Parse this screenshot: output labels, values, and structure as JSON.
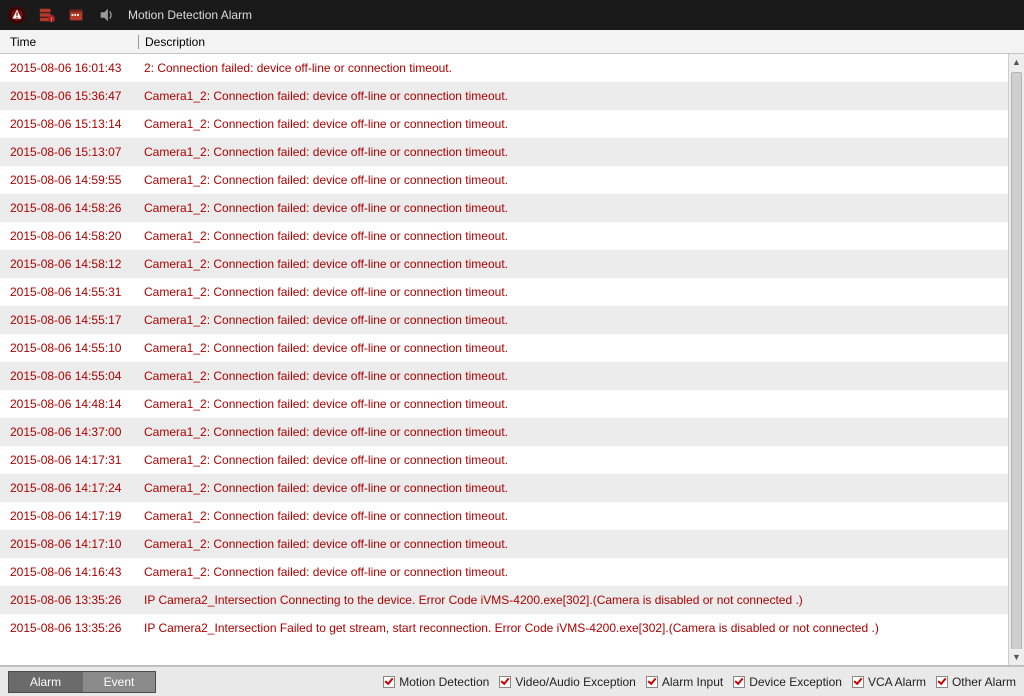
{
  "topbar": {
    "title": "Motion Detection Alarm",
    "icons": [
      "alert-icon",
      "server-alert-icon",
      "calendar-icon",
      "sound-icon"
    ]
  },
  "columns": {
    "time": "Time",
    "description": "Description"
  },
  "rows": [
    {
      "time": "2015-08-06 16:01:43",
      "desc": "2: Connection failed: device off-line or connection timeout."
    },
    {
      "time": "2015-08-06 15:36:47",
      "desc": "Camera1_2: Connection failed: device off-line or connection timeout."
    },
    {
      "time": "2015-08-06 15:13:14",
      "desc": "Camera1_2: Connection failed: device off-line or connection timeout."
    },
    {
      "time": "2015-08-06 15:13:07",
      "desc": "Camera1_2: Connection failed: device off-line or connection timeout."
    },
    {
      "time": "2015-08-06 14:59:55",
      "desc": "Camera1_2: Connection failed: device off-line or connection timeout."
    },
    {
      "time": "2015-08-06 14:58:26",
      "desc": "Camera1_2: Connection failed: device off-line or connection timeout."
    },
    {
      "time": "2015-08-06 14:58:20",
      "desc": "Camera1_2: Connection failed: device off-line or connection timeout."
    },
    {
      "time": "2015-08-06 14:58:12",
      "desc": "Camera1_2: Connection failed: device off-line or connection timeout."
    },
    {
      "time": "2015-08-06 14:55:31",
      "desc": "Camera1_2: Connection failed: device off-line or connection timeout."
    },
    {
      "time": "2015-08-06 14:55:17",
      "desc": "Camera1_2: Connection failed: device off-line or connection timeout."
    },
    {
      "time": "2015-08-06 14:55:10",
      "desc": "Camera1_2: Connection failed: device off-line or connection timeout."
    },
    {
      "time": "2015-08-06 14:55:04",
      "desc": "Camera1_2: Connection failed: device off-line or connection timeout."
    },
    {
      "time": "2015-08-06 14:48:14",
      "desc": "Camera1_2: Connection failed: device off-line or connection timeout."
    },
    {
      "time": "2015-08-06 14:37:00",
      "desc": "Camera1_2: Connection failed: device off-line or connection timeout."
    },
    {
      "time": "2015-08-06 14:17:31",
      "desc": "Camera1_2: Connection failed: device off-line or connection timeout."
    },
    {
      "time": "2015-08-06 14:17:24",
      "desc": "Camera1_2: Connection failed: device off-line or connection timeout."
    },
    {
      "time": "2015-08-06 14:17:19",
      "desc": "Camera1_2: Connection failed: device off-line or connection timeout."
    },
    {
      "time": "2015-08-06 14:17:10",
      "desc": "Camera1_2: Connection failed: device off-line or connection timeout."
    },
    {
      "time": "2015-08-06 14:16:43",
      "desc": "Camera1_2: Connection failed: device off-line or connection timeout."
    },
    {
      "time": "2015-08-06 13:35:26",
      "desc": "IP Camera2_Intersection Connecting to the device. Error Code iVMS-4200.exe[302].(Camera is disabled or not connected .)"
    },
    {
      "time": "2015-08-06 13:35:26",
      "desc": "IP Camera2_Intersection Failed to get stream, start reconnection. Error Code iVMS-4200.exe[302].(Camera is disabled or not connected .)"
    }
  ],
  "bottombar": {
    "alarm_btn": "Alarm",
    "event_btn": "Event",
    "filters": [
      {
        "label": "Motion Detection",
        "checked": true
      },
      {
        "label": "Video/Audio Exception",
        "checked": true
      },
      {
        "label": "Alarm Input",
        "checked": true
      },
      {
        "label": "Device Exception",
        "checked": true
      },
      {
        "label": "VCA Alarm",
        "checked": true
      },
      {
        "label": "Other Alarm",
        "checked": true
      }
    ]
  }
}
